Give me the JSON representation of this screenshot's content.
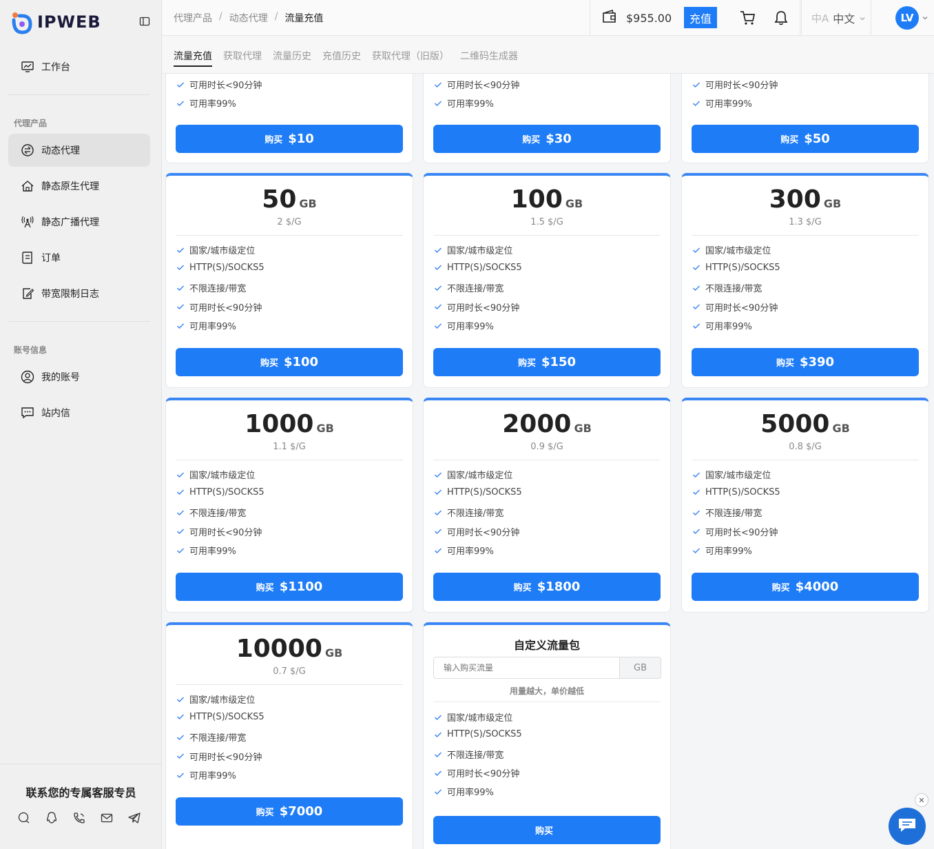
{
  "brand": {
    "name": "IPWEB"
  },
  "sidebar": {
    "workbench": "工作台",
    "section_proxy": "代理产品",
    "items": [
      {
        "label": "动态代理",
        "icon": "dynamic-proxy-icon"
      },
      {
        "label": "静态原生代理",
        "icon": "house-icon"
      },
      {
        "label": "静态广播代理",
        "icon": "antenna-icon"
      },
      {
        "label": "订单",
        "icon": "order-icon"
      },
      {
        "label": "带宽限制日志",
        "icon": "edit-log-icon"
      }
    ],
    "section_account": "账号信息",
    "account_items": [
      {
        "label": "我的账号",
        "icon": "user-icon"
      },
      {
        "label": "站内信",
        "icon": "message-icon"
      }
    ],
    "contact_title": "联系您的专属客服专员"
  },
  "topbar": {
    "breadcrumb": [
      "代理产品",
      "动态代理",
      "流量充值"
    ],
    "balance": "$955.00",
    "recharge_label": "充值",
    "language": "中文",
    "avatar": "LV"
  },
  "tabs": [
    "流量充值",
    "获取代理",
    "流量历史",
    "充值历史",
    "获取代理（旧版）",
    "二维码生成器"
  ],
  "features": [
    "国家/城市级定位",
    "HTTP(S)/SOCKS5",
    "不限连接/带宽",
    "可用时长<90分钟",
    "可用率99%"
  ],
  "buy_label": "购买",
  "top_row_prices": [
    "$10",
    "$30",
    "$50"
  ],
  "packages": [
    {
      "size": "50",
      "unit": "GB",
      "rate": "2 $/G",
      "price": "$100"
    },
    {
      "size": "100",
      "unit": "GB",
      "rate": "1.5 $/G",
      "price": "$150"
    },
    {
      "size": "300",
      "unit": "GB",
      "rate": "1.3 $/G",
      "price": "$390"
    },
    {
      "size": "1000",
      "unit": "GB",
      "rate": "1.1 $/G",
      "price": "$1100"
    },
    {
      "size": "2000",
      "unit": "GB",
      "rate": "0.9 $/G",
      "price": "$1800"
    },
    {
      "size": "5000",
      "unit": "GB",
      "rate": "0.8 $/G",
      "price": "$4000"
    },
    {
      "size": "10000",
      "unit": "GB",
      "rate": "0.7 $/G",
      "price": "$7000"
    }
  ],
  "custom": {
    "title": "自定义流量包",
    "placeholder": "输入购买流量",
    "unit": "GB",
    "hint": "用量越大，单价越低"
  },
  "colors": {
    "accent": "#1e7cf7",
    "card_top": "#3b86f5"
  }
}
